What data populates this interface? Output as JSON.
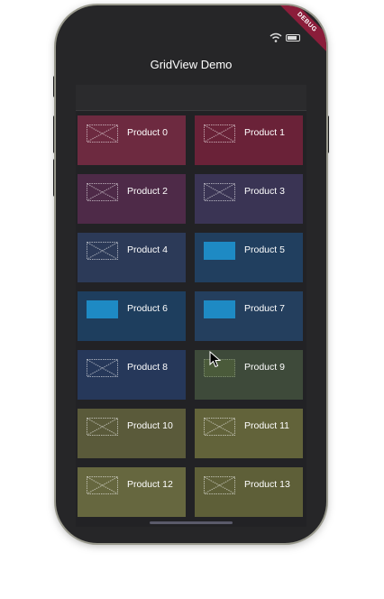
{
  "app_title": "GridView Demo",
  "debug_label": "DEBUG",
  "products": [
    {
      "label": "Product 0",
      "bg": "#6d2a40",
      "thumb": "placeholder"
    },
    {
      "label": "Product 1",
      "bg": "#6a2238",
      "thumb": "placeholder"
    },
    {
      "label": "Product 2",
      "bg": "#4e2a48",
      "thumb": "placeholder"
    },
    {
      "label": "Product 3",
      "bg": "#3a3454",
      "thumb": "placeholder"
    },
    {
      "label": "Product 4",
      "bg": "#2c3a58",
      "thumb": "placeholder"
    },
    {
      "label": "Product 5",
      "bg": "#213f5f",
      "thumb": "solid"
    },
    {
      "label": "Product 6",
      "bg": "#1e3e5e",
      "thumb": "solid"
    },
    {
      "label": "Product 7",
      "bg": "#243f5e",
      "thumb": "solid"
    },
    {
      "label": "Product 8",
      "bg": "#26385a",
      "thumb": "placeholder"
    },
    {
      "label": "Product 9",
      "bg": "#3e4a3a",
      "thumb": "olive"
    },
    {
      "label": "Product 10",
      "bg": "#5a5a3a",
      "thumb": "placeholder"
    },
    {
      "label": "Product 11",
      "bg": "#62633a",
      "thumb": "placeholder"
    },
    {
      "label": "Product 12",
      "bg": "#66673f",
      "thumb": "placeholder"
    },
    {
      "label": "Product 13",
      "bg": "#5e5f38",
      "thumb": "placeholder"
    }
  ]
}
